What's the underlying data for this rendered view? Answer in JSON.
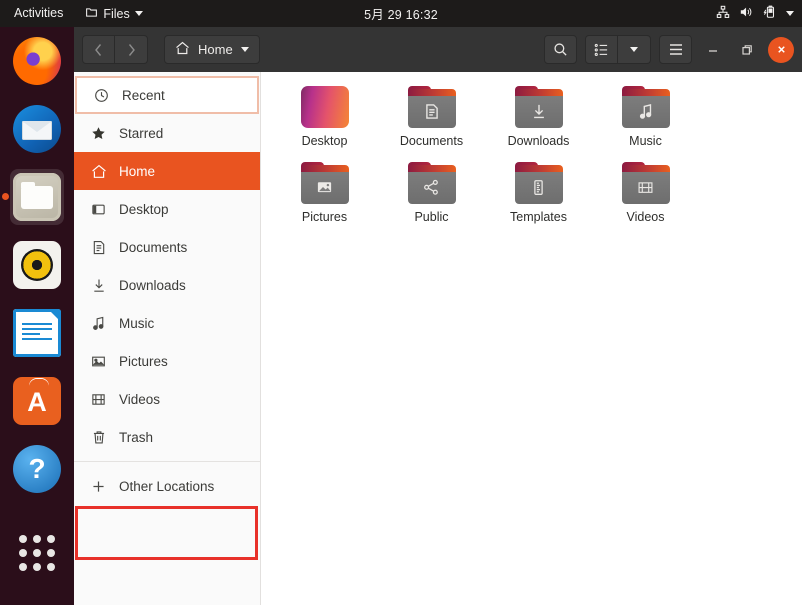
{
  "topbar": {
    "activities": "Activities",
    "app_menu": "Files",
    "app_icon": "files-icon",
    "clock": "5月 29  16:32",
    "tray_icons": [
      "network-icon",
      "volume-icon",
      "battery-icon",
      "caret-down-icon"
    ]
  },
  "dock": {
    "items": [
      {
        "name": "firefox",
        "label": "Firefox",
        "active": false
      },
      {
        "name": "thunderbird",
        "label": "Thunderbird Mail",
        "active": false
      },
      {
        "name": "files",
        "label": "Files",
        "active": true
      },
      {
        "name": "rhythmbox",
        "label": "Rhythmbox",
        "active": false
      },
      {
        "name": "libreoffice-writer",
        "label": "LibreOffice Writer",
        "active": false
      },
      {
        "name": "ubuntu-software",
        "label": "Ubuntu Software",
        "glyph": "A",
        "active": false
      },
      {
        "name": "help",
        "label": "Help",
        "glyph": "?",
        "active": false
      },
      {
        "name": "show-applications",
        "label": "Show Applications",
        "active": false
      }
    ]
  },
  "window": {
    "headerbar": {
      "back_label": "‹",
      "forward_label": "›",
      "path_label": "Home",
      "path_icon": "home-icon",
      "path_caret": "▾",
      "search_icon": "search-icon",
      "view_icon": "list-view-icon",
      "view_caret": "▾",
      "menu_icon": "hamburger-menu-icon",
      "minimize_label": "—",
      "maximize_label": "❐",
      "close_label": "✕"
    },
    "sidebar": {
      "items": [
        {
          "label": "Recent",
          "icon": "clock-icon",
          "state": "focus"
        },
        {
          "label": "Starred",
          "icon": "star-icon",
          "state": "normal"
        },
        {
          "label": "Home",
          "icon": "home-icon",
          "state": "active"
        },
        {
          "label": "Desktop",
          "icon": "desktop-icon",
          "state": "normal"
        },
        {
          "label": "Documents",
          "icon": "document-icon",
          "state": "normal"
        },
        {
          "label": "Downloads",
          "icon": "download-icon",
          "state": "normal"
        },
        {
          "label": "Music",
          "icon": "music-icon",
          "state": "normal"
        },
        {
          "label": "Pictures",
          "icon": "picture-icon",
          "state": "normal"
        },
        {
          "label": "Videos",
          "icon": "video-icon",
          "state": "normal"
        },
        {
          "label": "Trash",
          "icon": "trash-icon",
          "state": "normal"
        },
        {
          "label": "Other Locations",
          "icon": "plus-icon",
          "state": "annotated"
        }
      ]
    },
    "files": [
      {
        "label": "Desktop",
        "icon": "desktop-gradient-icon"
      },
      {
        "label": "Documents",
        "icon": "folder-documents-icon"
      },
      {
        "label": "Downloads",
        "icon": "folder-downloads-icon"
      },
      {
        "label": "Music",
        "icon": "folder-music-icon"
      },
      {
        "label": "Pictures",
        "icon": "folder-pictures-icon"
      },
      {
        "label": "Public",
        "icon": "folder-public-icon"
      },
      {
        "label": "Templates",
        "icon": "folder-templates-icon"
      },
      {
        "label": "Videos",
        "icon": "folder-videos-icon"
      }
    ]
  },
  "colors": {
    "ubuntu_orange": "#e95420",
    "annotation_red": "#e8312a",
    "focus_outline": "#f0bda8",
    "topbar_bg": "#1d1b1a",
    "headerbar_bg": "#343434",
    "sidebar_bg": "#fafafa"
  }
}
